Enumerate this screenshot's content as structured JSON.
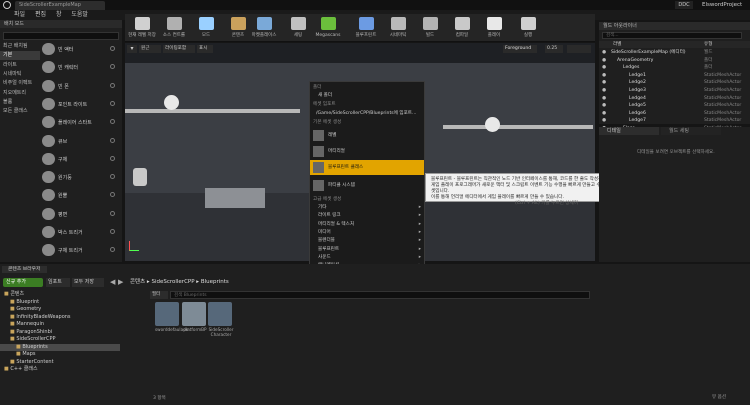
{
  "title_bar": {
    "tab": "SideScrollerExampleMap",
    "project_badge": "DDC",
    "project_name": "ElswordProject"
  },
  "menu_bar": [
    "파일",
    "편집",
    "창",
    "도움말"
  ],
  "toolbar": [
    {
      "label": "현재 레벨 저장",
      "color": "#d0d0d0"
    },
    {
      "label": "소스 컨트롤",
      "color": "#b0b0b0"
    },
    {
      "label": "모드",
      "color": "#9ad0ff"
    },
    {
      "label": "콘텐츠",
      "color": "#caa15c"
    },
    {
      "label": "마켓플레이스",
      "color": "#7aa9d8"
    },
    {
      "label": "세팅",
      "color": "#c0c0c0"
    },
    {
      "label": "Megascans",
      "color": "#6bbf3c"
    },
    {
      "label": "블루프린트",
      "color": "#6c9be3"
    },
    {
      "label": "시네마틱",
      "color": "#b9b9b9"
    },
    {
      "label": "빌드",
      "color": "#b3b3b3"
    },
    {
      "label": "컴파일",
      "color": "#c9c9c9"
    },
    {
      "label": "플레이",
      "color": "#e8e8e8"
    },
    {
      "label": "실행",
      "color": "#cfcfcf"
    }
  ],
  "modes": {
    "header": "배치 모드",
    "search_placeholder": "클래스 검색",
    "categories": [
      "최근 배치됨",
      "기본",
      "라이트",
      "시네마틱",
      "비주얼 이펙트",
      "지오메트리",
      "볼륨",
      "모든 클래스"
    ],
    "selected_category": 1,
    "items": [
      "빈 액터",
      "빈 캐릭터",
      "빈 폰",
      "포인트 라이트",
      "플레이어 스타트",
      "큐브",
      "구체",
      "원기둥",
      "원뿔",
      "평면",
      "박스 트리거",
      "구체 트리거"
    ]
  },
  "viewport": {
    "buttons": [
      "원근",
      "라이팅포함",
      "표시"
    ],
    "right_tools": [
      "Foreground",
      "0.25"
    ]
  },
  "context_menu": {
    "header_add": "폴더",
    "new_folder": "새 폴더",
    "import_header": "에셋 임포트",
    "import_item": "/Game/SideScrollerCPP/Blueprints에 임포트...",
    "basic_header": "기본 에셋 생성",
    "basic_items": [
      "레벨",
      "머티리얼",
      "블루프린트 클래스",
      "파티클 시스템"
    ],
    "advanced_header": "고급 에셋 생성",
    "advanced_items": [
      "기타",
      "라이트 링크",
      "머티리얼 & 텍스처",
      "미디어",
      "블렌더블",
      "블루프린트",
      "사운드",
      "애니메이션",
      "에디터 유틸리티",
      "유저 인터페이스",
      "인공 지능",
      "페이퍼 2D",
      "물리",
      "피직스",
      "FX"
    ]
  },
  "tooltip": {
    "lines": [
      "블루프린트 - 블루프린트는 직관적인 노드 기반 인터페이스를 통해, 코드를 한 줄도 작성하지 않고도 디자이너와",
      "게임 플레이 프로그래머가 새로운 액터 및 스크립트 이벤트 기능 수행을 빠르게 만들고 수정할 수 있게 해주는 특별한 에셋입니다.",
      "이를 통해 언리얼 에디터에서 게임 플레이를 빠르게 만들 수 있습니다.",
      "(Ctrl + Alt) 키를 누르면 상세히"
    ]
  },
  "outliner": {
    "header": "월드 아웃라이너",
    "search_placeholder": "검색...",
    "col_label": "라벨",
    "col_type": "유형",
    "rows": [
      {
        "name": "SideScrollerExampleMap (에디터)",
        "type": "월드",
        "indent": 0
      },
      {
        "name": "ArenaGeometry",
        "type": "폴더",
        "indent": 1
      },
      {
        "name": "Ledges",
        "type": "폴더",
        "indent": 2
      },
      {
        "name": "Ledge1",
        "type": "StaticMeshActor",
        "indent": 3
      },
      {
        "name": "Ledge2",
        "type": "StaticMeshActor",
        "indent": 3
      },
      {
        "name": "Ledge3",
        "type": "StaticMeshActor",
        "indent": 3
      },
      {
        "name": "Ledge4",
        "type": "StaticMeshActor",
        "indent": 3
      },
      {
        "name": "Ledge5",
        "type": "StaticMeshActor",
        "indent": 3
      },
      {
        "name": "Ledge6",
        "type": "StaticMeshActor",
        "indent": 3
      },
      {
        "name": "Ledge7",
        "type": "StaticMeshActor",
        "indent": 3
      },
      {
        "name": "Floor",
        "type": "StaticMeshActor",
        "indent": 2
      },
      {
        "name": "Wall",
        "type": "StaticMeshActor",
        "indent": 2
      }
    ]
  },
  "details": {
    "tab1": "디테일",
    "tab2": "월드 세팅",
    "message": "디테일을 보려면 오브젝트를 선택하세요."
  },
  "content_browser": {
    "tab": "콘텐츠 브라우저",
    "add_new": "신규 추가",
    "import": "임포트",
    "save_all": "모두 저장",
    "path": [
      "콘텐츠",
      "SideScrollerCPP",
      "Blueprints"
    ],
    "search_placeholder": "검색 Blueprints",
    "filter": "필터",
    "tree": [
      {
        "name": "콘텐츠",
        "indent": 0
      },
      {
        "name": "Blueprint",
        "indent": 1
      },
      {
        "name": "Geometry",
        "indent": 1
      },
      {
        "name": "InfinityBladeWeapons",
        "indent": 1
      },
      {
        "name": "Mannequin",
        "indent": 1
      },
      {
        "name": "ParagonShinbi",
        "indent": 1
      },
      {
        "name": "SideScrollerCPP",
        "indent": 1
      },
      {
        "name": "Blueprints",
        "indent": 2
      },
      {
        "name": "Maps",
        "indent": 2
      },
      {
        "name": "StarterContent",
        "indent": 1
      },
      {
        "name": "C++ 클래스",
        "indent": 0
      }
    ],
    "selected_tree": 7,
    "assets": [
      "sworddefaulade",
      "platformBP",
      "SideScroller Character"
    ],
    "count": "3 항목",
    "view_options": "뷰 옵션"
  }
}
